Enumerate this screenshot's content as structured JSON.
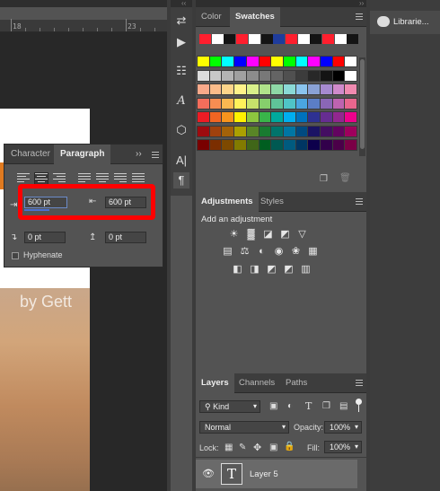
{
  "document": {
    "ruler_label": "18",
    "ruler_label2": "23",
    "watermark": "by Gett"
  },
  "paragraph_panel": {
    "tab_character": "Character",
    "tab_paragraph": "Paragraph",
    "collapse_glyph": "››",
    "left_indent": "600 pt",
    "right_indent": "600 pt",
    "first_line_indent": "0 pt",
    "space_before": "0 pt",
    "hyphenate_label": "Hyphenate",
    "hyphenate_checked": false
  },
  "color_panel": {
    "tab_color": "Color",
    "tab_swatches": "Swatches",
    "top_row": [
      "#ff1f2e",
      "#ffffff",
      "#141414",
      "#ff1f2e",
      "#ffffff",
      "#141414",
      "#1f3c9c",
      "#ff1f2e",
      "#ffffff",
      "#141414",
      "#ff1f2e",
      "#ffffff",
      "#141414"
    ],
    "grid": [
      [
        "#ffff00",
        "#00ff00",
        "#00ffff",
        "#0000ff",
        "#ff00ff",
        "#ff0000",
        "#ffff00",
        "#00ff00",
        "#00ffff",
        "#ff00ff",
        "#0000ff",
        "#ff0000",
        "#ffffff"
      ],
      [
        "#dcdcdc",
        "#c8c8c8",
        "#b4b4b4",
        "#a0a0a0",
        "#8c8c8c",
        "#787878",
        "#646464",
        "#505050",
        "#3c3c3c",
        "#282828",
        "#141414",
        "#000000",
        "#ffffff"
      ],
      [
        "#f9a98a",
        "#fbbc8a",
        "#fdd58a",
        "#fff38a",
        "#d9f08a",
        "#b0e28a",
        "#8ed8a6",
        "#8ad9d6",
        "#8ac4ee",
        "#8aa2d6",
        "#a68ad0",
        "#d08acb",
        "#f08ab0"
      ],
      [
        "#f36d5b",
        "#f68d52",
        "#fbb851",
        "#fff15a",
        "#c7e26b",
        "#86cf6c",
        "#5fc398",
        "#4fc4c7",
        "#4aa6e0",
        "#5b7ec6",
        "#8a66b6",
        "#bd63b0",
        "#e8668e"
      ],
      [
        "#ed1c24",
        "#f26522",
        "#f7941d",
        "#fff200",
        "#8dc63f",
        "#39b54a",
        "#00a99d",
        "#00aeef",
        "#0072bc",
        "#2e3192",
        "#662d91",
        "#92278f",
        "#ec008c"
      ],
      [
        "#9e0b0f",
        "#a0410d",
        "#a36209",
        "#aba000",
        "#598527",
        "#197b30",
        "#00746b",
        "#0076a3",
        "#004a80",
        "#1b1464",
        "#440e62",
        "#630460",
        "#9e005d"
      ],
      [
        "#790000",
        "#7b2e00",
        "#7d4900",
        "#827b00",
        "#406618",
        "#005e20",
        "#005952",
        "#005b7f",
        "#003663",
        "#0d004c",
        "#32004b",
        "#4b0049",
        "#7b0046"
      ]
    ]
  },
  "adjustments_panel": {
    "tab_adjustments": "Adjustments",
    "tab_styles": "Styles",
    "heading": "Add an adjustment",
    "row1": [
      "brightness-contrast",
      "levels",
      "curves",
      "exposure",
      "vibrance"
    ],
    "row2": [
      "hue-saturation",
      "color-balance",
      "black-white",
      "photo-filter",
      "channel-mixer",
      "color-lookup"
    ],
    "row3": [
      "invert",
      "posterize",
      "threshold",
      "selective-color",
      "gradient-map"
    ]
  },
  "layers_panel": {
    "tab_layers": "Layers",
    "tab_channels": "Channels",
    "tab_paths": "Paths",
    "filter_kind": "Kind",
    "blend_mode": "Normal",
    "opacity_label": "Opacity:",
    "opacity_value": "100%",
    "lock_label": "Lock:",
    "fill_label": "Fill:",
    "fill_value": "100%",
    "layer_name": "Layer 5",
    "layer_thumb": "T"
  },
  "libraries": {
    "label": "Librarie..."
  }
}
